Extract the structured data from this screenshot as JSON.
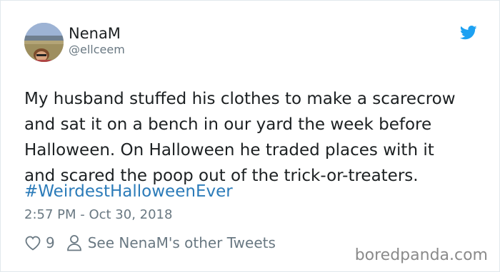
{
  "tweet": {
    "display_name": "NenaM",
    "handle": "@ellceem",
    "text_lines": [
      "My husband stuffed his clothes to make a scarecrow",
      "and sat it on a bench in our yard the week before",
      "Halloween. On Halloween he traded places with it",
      "and scared the poop out of the trick-or-treaters."
    ],
    "hashtag": "#WeirdestHalloweenEver",
    "timestamp": "2:57 PM - Oct 30, 2018",
    "like_count": "9",
    "other_tweets_label": "See NenaM's other Tweets",
    "icons": {
      "platform": "twitter-bird-icon",
      "like": "heart-icon",
      "profile": "person-icon"
    }
  },
  "watermark": "boredpanda.com",
  "colors": {
    "link": "#2b7bb9",
    "secondary_text": "#697882",
    "twitter_blue": "#1da1f2",
    "body_text": "#1c2022"
  }
}
